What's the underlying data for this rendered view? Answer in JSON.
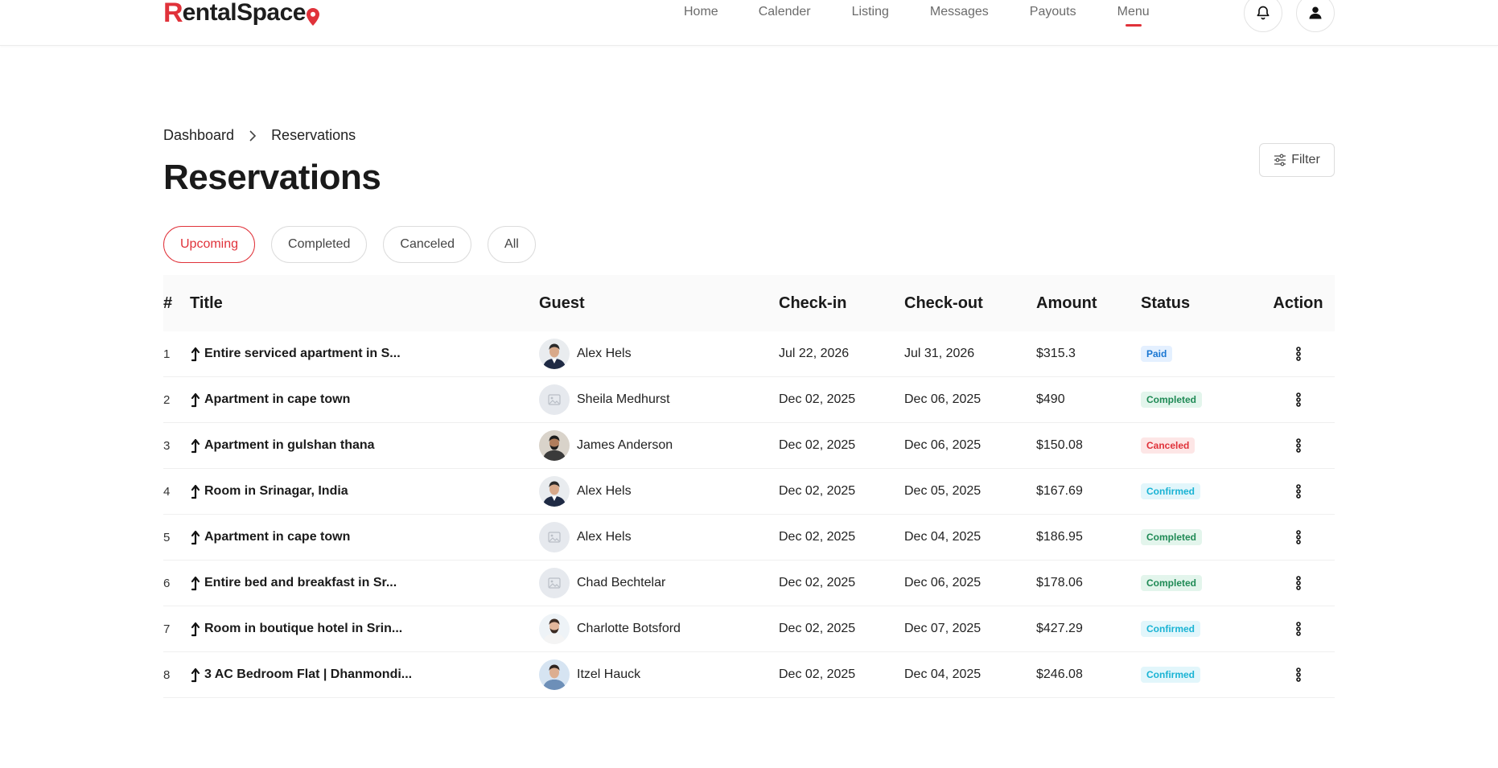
{
  "brand": {
    "logo_first": "R",
    "logo_rest": "entalSpace",
    "accent": "#e0323a"
  },
  "nav": {
    "items": [
      {
        "label": "Home",
        "left": 0
      },
      {
        "label": "Calender"
      },
      {
        "label": "Listing"
      },
      {
        "label": "Messages"
      },
      {
        "label": "Payouts"
      },
      {
        "label": "Menu",
        "active": true
      }
    ]
  },
  "header_icons": [
    "bell-icon",
    "user-icon"
  ],
  "breadcrumb": {
    "root": "Dashboard",
    "current": "Reservations"
  },
  "page": {
    "title": "Reservations",
    "filter_label": "Filter"
  },
  "tabs": [
    {
      "label": "Upcoming",
      "active": true
    },
    {
      "label": "Completed"
    },
    {
      "label": "Canceled"
    },
    {
      "label": "All"
    }
  ],
  "table": {
    "headers": {
      "num": "#",
      "title": "Title",
      "guest": "Guest",
      "checkin": "Check-in",
      "checkout": "Check-out",
      "amount": "Amount",
      "status": "Status",
      "action": "Action"
    },
    "rows": [
      {
        "num": "1",
        "title": "Entire serviced apartment in S...",
        "guest": "Alex Hels",
        "avatar": "photo-man-suit",
        "checkin": "Jul 22, 2026",
        "checkout": "Jul 31, 2026",
        "amount": "$315.3",
        "status": "Paid",
        "status_type": "paid"
      },
      {
        "num": "2",
        "title": "Apartment in cape town",
        "guest": "Sheila Medhurst",
        "avatar": "placeholder",
        "checkin": "Dec 02, 2025",
        "checkout": "Dec 06, 2025",
        "amount": "$490",
        "status": "Completed",
        "status_type": "completed"
      },
      {
        "num": "3",
        "title": "Apartment in gulshan thana",
        "guest": "James Anderson",
        "avatar": "photo-man-beard",
        "checkin": "Dec 02, 2025",
        "checkout": "Dec 06, 2025",
        "amount": "$150.08",
        "status": "Canceled",
        "status_type": "canceled"
      },
      {
        "num": "4",
        "title": "Room in Srinagar, India",
        "guest": "Alex Hels",
        "avatar": "photo-man-suit",
        "checkin": "Dec 02, 2025",
        "checkout": "Dec 05, 2025",
        "amount": "$167.69",
        "status": "Confirmed",
        "status_type": "confirmed"
      },
      {
        "num": "5",
        "title": "Apartment in cape town",
        "guest": "Alex Hels",
        "avatar": "placeholder",
        "checkin": "Dec 02, 2025",
        "checkout": "Dec 04, 2025",
        "amount": "$186.95",
        "status": "Completed",
        "status_type": "completed"
      },
      {
        "num": "6",
        "title": "Entire bed and breakfast in Sr...",
        "guest": "Chad Bechtelar",
        "avatar": "placeholder",
        "checkin": "Dec 02, 2025",
        "checkout": "Dec 06, 2025",
        "amount": "$178.06",
        "status": "Completed",
        "status_type": "completed"
      },
      {
        "num": "7",
        "title": "Room in boutique hotel in Srin...",
        "guest": "Charlotte Botsford",
        "avatar": "photo-man-white",
        "checkin": "Dec 02, 2025",
        "checkout": "Dec 07, 2025",
        "amount": "$427.29",
        "status": "Confirmed",
        "status_type": "confirmed"
      },
      {
        "num": "8",
        "title": "3 AC Bedroom Flat | Dhanmondi...",
        "guest": "Itzel Hauck",
        "avatar": "photo-man-blue",
        "checkin": "Dec 02, 2025",
        "checkout": "Dec 04, 2025",
        "amount": "$246.08",
        "status": "Confirmed",
        "status_type": "confirmed"
      }
    ]
  }
}
